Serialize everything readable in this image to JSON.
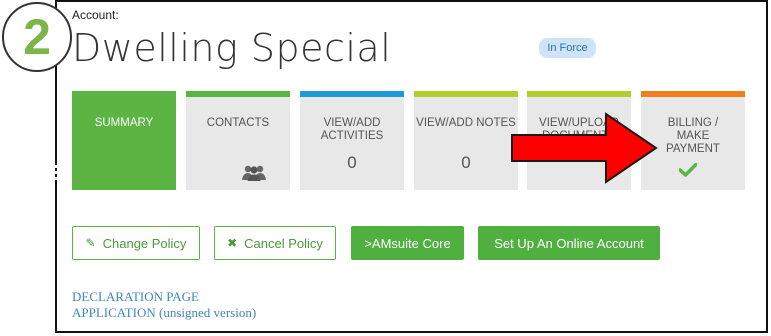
{
  "step_badge": "2",
  "header": {
    "account_label": "Account:",
    "policy_title": "Dwelling Special",
    "status_badge": "In Force"
  },
  "tiles": [
    {
      "label": "SUMMARY",
      "accent": "#5cb543",
      "icon": "hamburger-icon"
    },
    {
      "label": "CONTACTS",
      "accent": "#5cb543",
      "icon": "users-icon"
    },
    {
      "label": "VIEW/ADD ACTIVITIES",
      "accent": "#1e9bd6",
      "count": "0"
    },
    {
      "label": "VIEW/ADD NOTES",
      "accent": "#b5cc2e",
      "count": "0"
    },
    {
      "label": "VIEW/UPLOAD DOCUMENTS",
      "accent": "#b5cc2e"
    },
    {
      "label": "BILLING / MAKE PAYMENT",
      "accent": "#f07f1e",
      "icon": "check-icon"
    }
  ],
  "buttons": {
    "change_policy": "Change Policy",
    "cancel_policy": "Cancel Policy",
    "amsuite_core": ">AMsuite Core",
    "online_account": "Set Up An Online Account"
  },
  "links": {
    "declaration_page": "DECLARATION PAGE",
    "application": "APPLICATION (unsigned version)"
  },
  "colors": {
    "accent_green": "#5cb543",
    "link_blue": "#3f85c4",
    "arrow_red": "#ff0000"
  }
}
